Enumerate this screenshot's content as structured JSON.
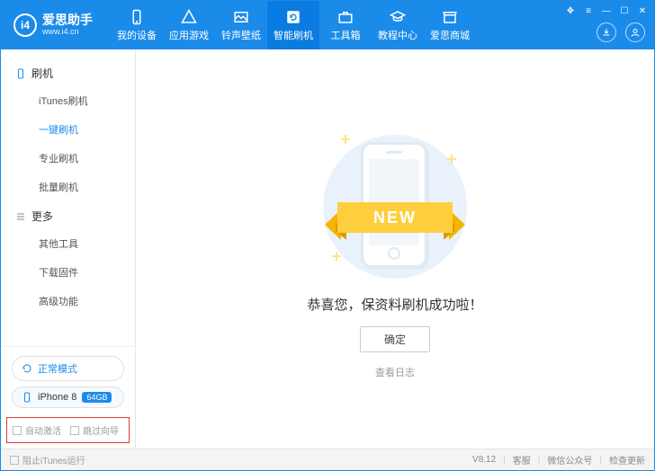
{
  "app": {
    "title": "爱思助手",
    "url": "www.i4.cn",
    "version_label": "V8.12"
  },
  "header": {
    "tabs": [
      {
        "label": "我的设备"
      },
      {
        "label": "应用游戏"
      },
      {
        "label": "铃声壁纸"
      },
      {
        "label": "智能刷机",
        "active": true
      },
      {
        "label": "工具箱"
      },
      {
        "label": "教程中心"
      },
      {
        "label": "爱思商城"
      }
    ]
  },
  "sidebar": {
    "groups": [
      {
        "title": "刷机",
        "items": [
          {
            "label": "iTunes刷机"
          },
          {
            "label": "一键刷机",
            "active": true
          },
          {
            "label": "专业刷机"
          },
          {
            "label": "批量刷机"
          }
        ]
      },
      {
        "title": "更多",
        "items": [
          {
            "label": "其他工具"
          },
          {
            "label": "下载固件"
          },
          {
            "label": "高级功能"
          }
        ]
      }
    ],
    "mode_label": "正常模式",
    "device_name": "iPhone 8",
    "device_capacity": "64GB",
    "check_auto_activate": "自动激活",
    "check_skip_guide": "跳过向导"
  },
  "main": {
    "new_banner": "NEW",
    "message": "恭喜您，保资料刷机成功啦！",
    "ok_button": "确定",
    "view_log": "查看日志"
  },
  "statusbar": {
    "block_itunes": "阻止iTunes运行",
    "links": [
      "客服",
      "微信公众号",
      "检查更新"
    ]
  }
}
